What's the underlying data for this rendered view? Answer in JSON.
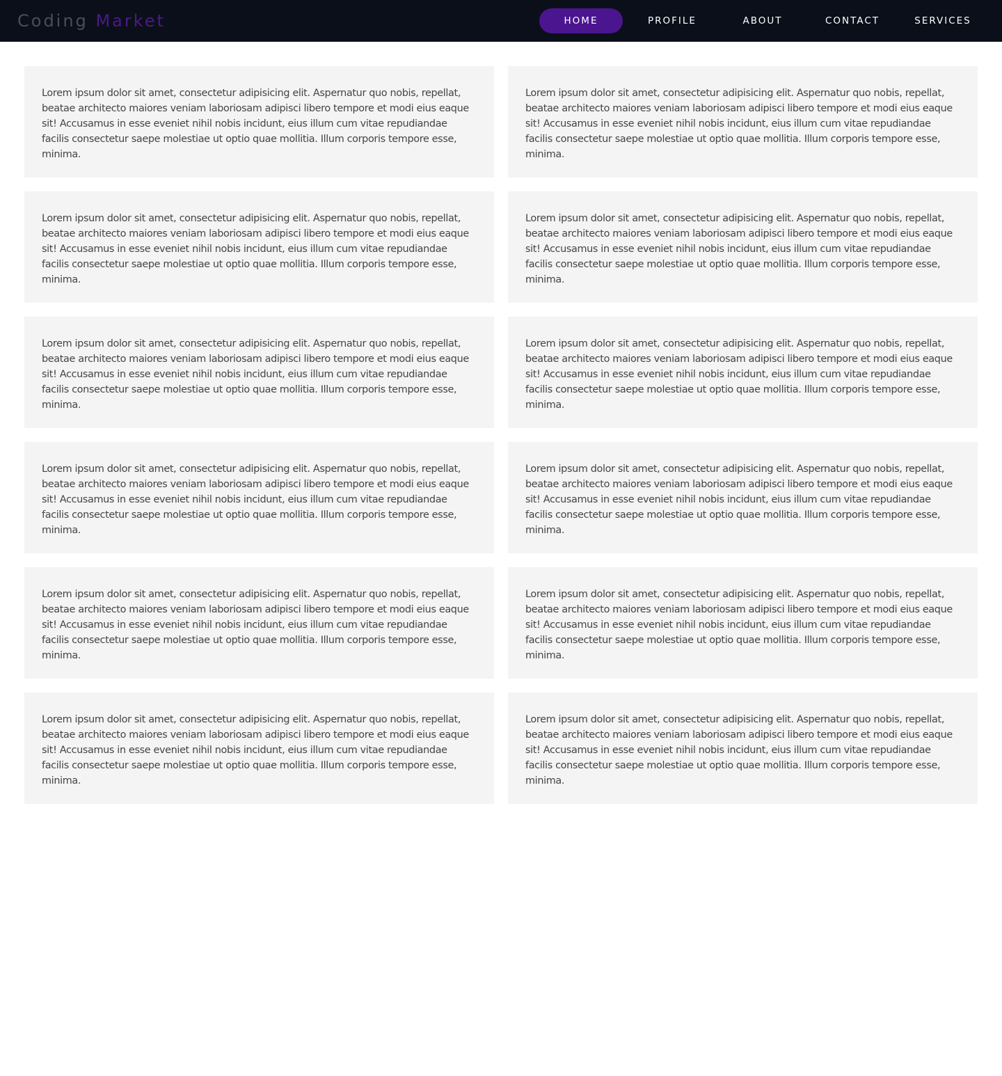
{
  "brand": {
    "part1": "Coding",
    "part2": "Market"
  },
  "nav": {
    "items": [
      {
        "label": "HOME",
        "active": true
      },
      {
        "label": "PROFILE",
        "active": false
      },
      {
        "label": "ABOUT",
        "active": false
      },
      {
        "label": "CONTACT",
        "active": false
      },
      {
        "label": "SERVICES",
        "active": false
      }
    ]
  },
  "colors": {
    "navbar_bg": "#0b0f19",
    "accent": "#4b1590",
    "card_bg": "#f4f4f4",
    "text": "#444444"
  },
  "cards": [
    {
      "text": "Lorem ipsum dolor sit amet, consectetur adipisicing elit. Aspernatur quo nobis, repellat, beatae architecto maiores veniam laboriosam adipisci libero tempore et modi eius eaque sit! Accusamus in esse eveniet nihil nobis incidunt, eius illum cum vitae repudiandae facilis consectetur saepe molestiae ut optio quae mollitia. Illum corporis tempore esse, minima."
    },
    {
      "text": "Lorem ipsum dolor sit amet, consectetur adipisicing elit. Aspernatur quo nobis, repellat, beatae architecto maiores veniam laboriosam adipisci libero tempore et modi eius eaque sit! Accusamus in esse eveniet nihil nobis incidunt, eius illum cum vitae repudiandae facilis consectetur saepe molestiae ut optio quae mollitia. Illum corporis tempore esse, minima."
    },
    {
      "text": "Lorem ipsum dolor sit amet, consectetur adipisicing elit. Aspernatur quo nobis, repellat, beatae architecto maiores veniam laboriosam adipisci libero tempore et modi eius eaque sit! Accusamus in esse eveniet nihil nobis incidunt, eius illum cum vitae repudiandae facilis consectetur saepe molestiae ut optio quae mollitia. Illum corporis tempore esse, minima."
    },
    {
      "text": "Lorem ipsum dolor sit amet, consectetur adipisicing elit. Aspernatur quo nobis, repellat, beatae architecto maiores veniam laboriosam adipisci libero tempore et modi eius eaque sit! Accusamus in esse eveniet nihil nobis incidunt, eius illum cum vitae repudiandae facilis consectetur saepe molestiae ut optio quae mollitia. Illum corporis tempore esse, minima."
    },
    {
      "text": "Lorem ipsum dolor sit amet, consectetur adipisicing elit. Aspernatur quo nobis, repellat, beatae architecto maiores veniam laboriosam adipisci libero tempore et modi eius eaque sit! Accusamus in esse eveniet nihil nobis incidunt, eius illum cum vitae repudiandae facilis consectetur saepe molestiae ut optio quae mollitia. Illum corporis tempore esse, minima."
    },
    {
      "text": "Lorem ipsum dolor sit amet, consectetur adipisicing elit. Aspernatur quo nobis, repellat, beatae architecto maiores veniam laboriosam adipisci libero tempore et modi eius eaque sit! Accusamus in esse eveniet nihil nobis incidunt, eius illum cum vitae repudiandae facilis consectetur saepe molestiae ut optio quae mollitia. Illum corporis tempore esse, minima."
    },
    {
      "text": "Lorem ipsum dolor sit amet, consectetur adipisicing elit. Aspernatur quo nobis, repellat, beatae architecto maiores veniam laboriosam adipisci libero tempore et modi eius eaque sit! Accusamus in esse eveniet nihil nobis incidunt, eius illum cum vitae repudiandae facilis consectetur saepe molestiae ut optio quae mollitia. Illum corporis tempore esse, minima."
    },
    {
      "text": "Lorem ipsum dolor sit amet, consectetur adipisicing elit. Aspernatur quo nobis, repellat, beatae architecto maiores veniam laboriosam adipisci libero tempore et modi eius eaque sit! Accusamus in esse eveniet nihil nobis incidunt, eius illum cum vitae repudiandae facilis consectetur saepe molestiae ut optio quae mollitia. Illum corporis tempore esse, minima."
    },
    {
      "text": "Lorem ipsum dolor sit amet, consectetur adipisicing elit. Aspernatur quo nobis, repellat, beatae architecto maiores veniam laboriosam adipisci libero tempore et modi eius eaque sit! Accusamus in esse eveniet nihil nobis incidunt, eius illum cum vitae repudiandae facilis consectetur saepe molestiae ut optio quae mollitia. Illum corporis tempore esse, minima."
    },
    {
      "text": "Lorem ipsum dolor sit amet, consectetur adipisicing elit. Aspernatur quo nobis, repellat, beatae architecto maiores veniam laboriosam adipisci libero tempore et modi eius eaque sit! Accusamus in esse eveniet nihil nobis incidunt, eius illum cum vitae repudiandae facilis consectetur saepe molestiae ut optio quae mollitia. Illum corporis tempore esse, minima."
    },
    {
      "text": "Lorem ipsum dolor sit amet, consectetur adipisicing elit. Aspernatur quo nobis, repellat, beatae architecto maiores veniam laboriosam adipisci libero tempore et modi eius eaque sit! Accusamus in esse eveniet nihil nobis incidunt, eius illum cum vitae repudiandae facilis consectetur saepe molestiae ut optio quae mollitia. Illum corporis tempore esse, minima."
    },
    {
      "text": "Lorem ipsum dolor sit amet, consectetur adipisicing elit. Aspernatur quo nobis, repellat, beatae architecto maiores veniam laboriosam adipisci libero tempore et modi eius eaque sit! Accusamus in esse eveniet nihil nobis incidunt, eius illum cum vitae repudiandae facilis consectetur saepe molestiae ut optio quae mollitia. Illum corporis tempore esse, minima."
    }
  ]
}
